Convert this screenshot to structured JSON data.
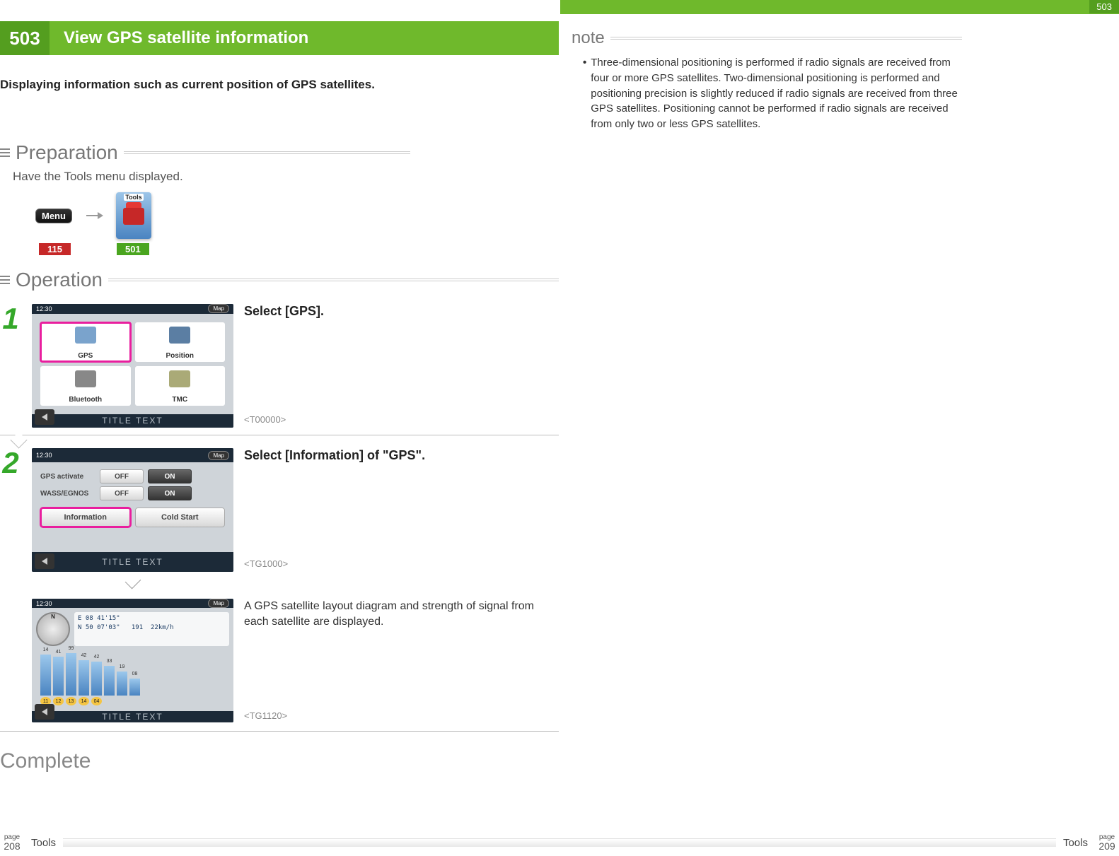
{
  "topbar": {
    "section_number_right": "503"
  },
  "title": {
    "number": "503",
    "text": "View GPS satellite information"
  },
  "intro": "Displaying information such as current position of GPS satellites.",
  "preparation": {
    "heading": "Preparation",
    "body": "Have the Tools menu displayed.",
    "menu_label": "Menu",
    "tools_label": "Tools",
    "ref_menu": "115",
    "ref_tools": "501"
  },
  "operation": {
    "heading": "Operation",
    "step1": {
      "num": "1",
      "instruction": "Select [GPS].",
      "code": "<T00000>",
      "time": "12:30",
      "map": "Map",
      "title_text": "TITLE TEXT",
      "tiles": {
        "gps": "GPS",
        "position": "Position",
        "bluetooth": "Bluetooth",
        "tmc": "TMC"
      }
    },
    "step2": {
      "num": "2",
      "instruction": "Select [Information] of \"GPS\".",
      "code": "<TG1000>",
      "time": "12:30",
      "map": "Map",
      "title_text": "TITLE TEXT",
      "rows": {
        "gps_activate": "GPS activate",
        "wass": "WASS/EGNOS",
        "off": "OFF",
        "on": "ON",
        "info": "Information",
        "cold": "Cold Start"
      }
    },
    "result": {
      "desc": "A GPS satellite layout diagram and strength of signal from each satellite are displayed.",
      "code": "<TG1120>",
      "time": "12:30",
      "map": "Map",
      "title_text": "TITLE TEXT",
      "readout": {
        "lat": "08 41'15\"",
        "dir": "E",
        "lon": "50 07'03\"",
        "dir2": "N",
        "alt": "191",
        "spd": "22km/h"
      },
      "bar_labels": [
        "14",
        "41",
        "99",
        "42",
        "42",
        "33",
        "19",
        "08"
      ],
      "dot_labels": [
        "11",
        "12",
        "13",
        "14",
        "04"
      ]
    }
  },
  "complete": "Complete",
  "note": {
    "heading": "note",
    "body": "Three-dimensional positioning is performed if radio signals are received from four or more GPS satellites. Two-dimensional positioning is performed and positioning precision is slightly reduced if radio signals are received from three GPS satellites. Positioning cannot be performed if radio signals are received from only two or less GPS satellites."
  },
  "footer": {
    "left_page_label": "page",
    "left_page": "208",
    "right_page_label": "page",
    "right_page": "209",
    "chapter": "Tools"
  }
}
